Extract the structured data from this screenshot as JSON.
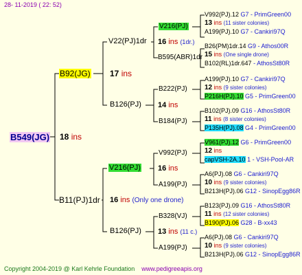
{
  "header": {
    "date": "28- 11-2019 ( 22: 52)"
  },
  "footer": {
    "copyright": "Copyright 2004-2019 @ Karl Kehrle Foundation",
    "site": "www.pedigreeapis.org"
  },
  "colors": {
    "purple_text": "#8b00b0",
    "yellow_hl": "#ffff00",
    "green_hl": "#33dd33",
    "cyan_hl": "#22ddff",
    "ins_red": "#c00000",
    "note_blue": "#2222cc"
  },
  "pedigree": {
    "root": {
      "name": "B549(JG)",
      "num": "18",
      "ins": "ins"
    },
    "g2": [
      {
        "name": "B92(JG)",
        "num": "17",
        "ins": "ins",
        "note": ""
      },
      {
        "name": "B11(PJ)1dr",
        "num": "16",
        "ins": "ins",
        "note": "(Only one drone)"
      }
    ],
    "g3": [
      {
        "name": "V22(PJ)1dr",
        "num": "16",
        "ins": "ins",
        "note": "(1dr.)"
      },
      {
        "name": "B126(PJ)",
        "num": "14",
        "ins": "ins",
        "note": ""
      },
      {
        "name": "V216(PJ)",
        "num": "16",
        "ins": "ins",
        "note": ""
      },
      {
        "name": "B126(PJ)",
        "num": "13",
        "ins": "ins",
        "note": "(11 c.)"
      }
    ],
    "g4": [
      {
        "name": "V216(PJ)",
        "num": "",
        "ins": "",
        "note": ""
      },
      {
        "name": "B595(ABR)1dr",
        "num": "",
        "ins": "",
        "note": ""
      },
      {
        "name": "B222(PJ)",
        "num": "",
        "ins": "",
        "note": ""
      },
      {
        "name": "B184(PJ)",
        "num": "",
        "ins": "",
        "note": ""
      },
      {
        "name": "V992(PJ)",
        "num": "",
        "ins": "",
        "note": ""
      },
      {
        "name": "A199(PJ)",
        "num": "13",
        "ins": "ins",
        "note": "(11 c.)"
      },
      {
        "name": "B328(VJ)",
        "num": "",
        "ins": "",
        "note": ""
      },
      {
        "name": "A199(PJ)",
        "num": "",
        "ins": "",
        "note": ""
      }
    ],
    "g5": [
      {
        "a": "V992(PJ).12",
        "src_a": "G7 - PrimGreen00",
        "num": "13",
        "ins": "ins",
        "note": "(11 sister colonies)",
        "b": "A199(PJ).10",
        "src_b": "G7 - Cankiri97Q"
      },
      {
        "a": "B26(PM)1dr.14",
        "src_a": "G9 - Athos00R",
        "num": "15",
        "ins": "ins",
        "note": "(One single drone)",
        "b": "B102(RL)1dr.647",
        "src_b": "- AthosSt80R"
      },
      {
        "a": "A199(PJ).10",
        "src_a": "G7 - Cankiri97Q",
        "num": "12",
        "ins": "ins",
        "note": "(9 sister colonies)",
        "b": "P216H(PJ).10",
        "src_b": "G5 - PrimGreen00"
      },
      {
        "a": "B102(PJ).09",
        "src_a": "G16 - AthosSt80R",
        "num": "11",
        "ins": "ins",
        "note": "(8 sister colonies)",
        "b": "P135H(PJ).08",
        "src_b": "G4 - PrimGreen00"
      },
      {
        "a": "V961(PJ).12",
        "src_a": "G6 - PrimGreen00",
        "num": "12",
        "ins": "ins",
        "note": "",
        "b": "capVSH-2A.10",
        "src_b": "1 - VSH-Pool-AR"
      },
      {
        "a": "A6(PJ).08",
        "src_a": "G6 - Cankiri97Q",
        "num": "10",
        "ins": "ins",
        "note": "(9 sister colonies)",
        "b": "B213H(PJ).06",
        "src_b": "G12 - SinopEgg86R"
      },
      {
        "a": "B123(PJ).09",
        "src_a": "G16 - AthosSt80R",
        "num": "11",
        "ins": "ins",
        "note": "(12 sister colonies)",
        "b": "B190(PJ).06",
        "src_b": "G28 - B-xx43"
      },
      {
        "a": "A6(PJ).08",
        "src_a": "G6 - Cankiri97Q",
        "num": "10",
        "ins": "ins",
        "note": "(9 sister colonies)",
        "b": "B213H(PJ).06",
        "src_b": "G12 - SinopEgg86R"
      }
    ]
  }
}
